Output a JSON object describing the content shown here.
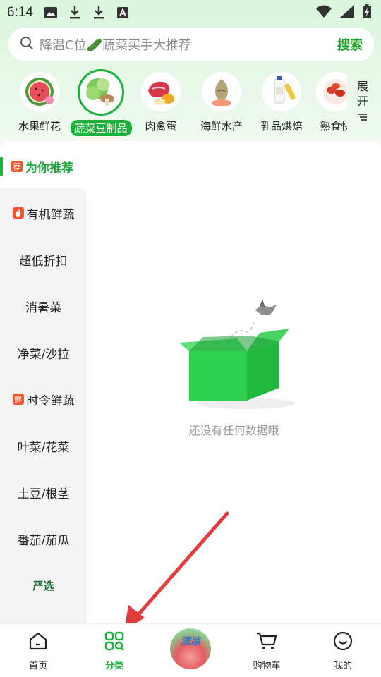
{
  "status_bar": {
    "time": "6:14"
  },
  "search": {
    "placeholder": "降温C位🥒蔬菜买手大推荐",
    "button": "搜索"
  },
  "categories": [
    {
      "label": "水果鲜花",
      "icon": "watermelon-icon"
    },
    {
      "label": "蔬菜豆制品",
      "icon": "vegetables-icon",
      "active": true
    },
    {
      "label": "肉禽蛋",
      "icon": "meat-egg-icon"
    },
    {
      "label": "海鲜水产",
      "icon": "fish-icon"
    },
    {
      "label": "乳品烘焙",
      "icon": "milk-icon"
    },
    {
      "label": "熟食快",
      "icon": "crayfish-icon"
    }
  ],
  "expand": {
    "line1": "展",
    "line2": "开"
  },
  "sidebar": {
    "active": {
      "tag": "荐",
      "label": "为你推荐"
    },
    "items": [
      {
        "label": "有机鲜蔬",
        "tag": "fire"
      },
      {
        "label": "超低折扣"
      },
      {
        "label": "消暑菜"
      },
      {
        "label": "净菜/沙拉"
      },
      {
        "label": "时令鲜蔬",
        "tag": "鲜"
      },
      {
        "label": "叶菜/花菜"
      },
      {
        "label": "土豆/根茎"
      },
      {
        "label": "番茄/茄瓜"
      },
      {
        "label": "严选"
      }
    ]
  },
  "empty": {
    "text": "还没有任何数据哦"
  },
  "nav": {
    "home": "首页",
    "category": "分类",
    "promo": "清凉",
    "cart": "购物车",
    "mine": "我的"
  },
  "colors": {
    "accent": "#19b23a",
    "tag_red": "#f2552c"
  }
}
